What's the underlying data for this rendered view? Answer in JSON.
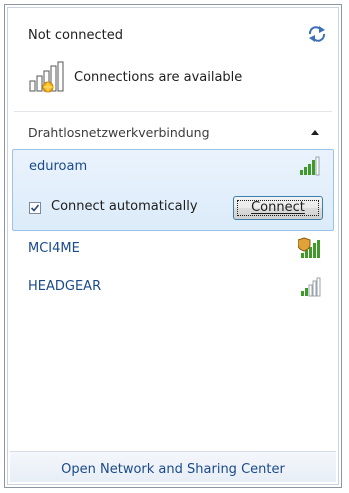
{
  "header": {
    "status": "Not connected",
    "connections_text": "Connections are available",
    "refresh_icon": "refresh-icon",
    "network_icon": "network-bars-with-star-icon"
  },
  "section": {
    "title": "Drahtlosnetzwerkverbindung",
    "collapse_icon": "chevron-up-icon"
  },
  "networks": [
    {
      "name": "eduroam",
      "signal_icon": "signal-strength-icon",
      "secured": false,
      "selected": true
    },
    {
      "name": "MCI4ME",
      "signal_icon": "signal-strength-shield-icon",
      "secured": true,
      "selected": false
    },
    {
      "name": "HEADGEAR",
      "signal_icon": "signal-strength-icon",
      "secured": false,
      "selected": false
    }
  ],
  "selected_options": {
    "auto_connect_label": "Connect automatically",
    "auto_connect_checked": true,
    "connect_button": "Connect"
  },
  "footer": {
    "link": "Open Network and Sharing Center"
  },
  "colors": {
    "link_blue": "#1a4a8a",
    "signal_green": "#3f9a2a",
    "signal_gray": "#9aa3ad",
    "selection_border": "#9cc4ea"
  }
}
